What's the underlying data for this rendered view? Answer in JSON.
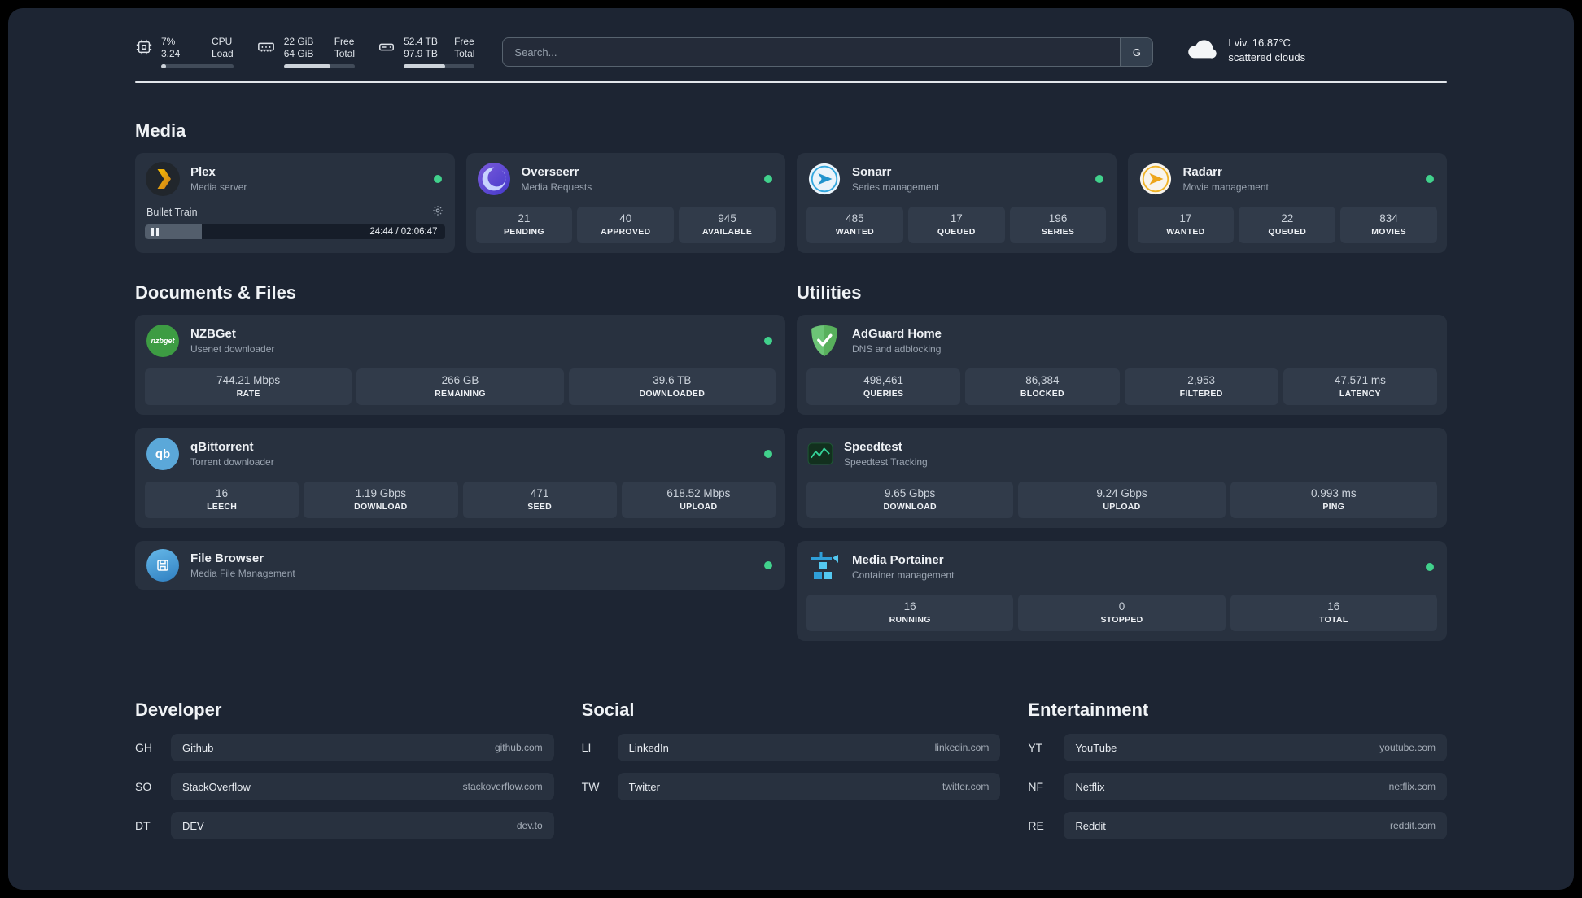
{
  "topbar": {
    "cpu": {
      "value": "7%",
      "total": "3.24",
      "label_top": "CPU",
      "label_bottom": "Load",
      "percent": 7
    },
    "ram": {
      "value": "22 GiB",
      "total": "64 GiB",
      "label_top": "Free",
      "label_bottom": "Total",
      "percent": 66
    },
    "disk": {
      "value": "52.4 TB",
      "total": "97.9 TB",
      "label_top": "Free",
      "label_bottom": "Total",
      "percent": 58
    },
    "search": {
      "placeholder": "Search...",
      "provider": "G"
    },
    "weather": {
      "location": "Lviv, 16.87°C",
      "condition": "scattered clouds"
    }
  },
  "sections": {
    "media": {
      "title": "Media",
      "plex": {
        "name": "Plex",
        "subtitle": "Media server",
        "player": {
          "track": "Bullet Train",
          "time": "24:44 / 02:06:47",
          "progress_percent": 19
        }
      },
      "overseerr": {
        "name": "Overseerr",
        "subtitle": "Media Requests",
        "stats": [
          {
            "value": "21",
            "label": "PENDING"
          },
          {
            "value": "40",
            "label": "APPROVED"
          },
          {
            "value": "945",
            "label": "AVAILABLE"
          }
        ]
      },
      "sonarr": {
        "name": "Sonarr",
        "subtitle": "Series management",
        "stats": [
          {
            "value": "485",
            "label": "WANTED"
          },
          {
            "value": "17",
            "label": "QUEUED"
          },
          {
            "value": "196",
            "label": "SERIES"
          }
        ]
      },
      "radarr": {
        "name": "Radarr",
        "subtitle": "Movie management",
        "stats": [
          {
            "value": "17",
            "label": "WANTED"
          },
          {
            "value": "22",
            "label": "QUEUED"
          },
          {
            "value": "834",
            "label": "MOVIES"
          }
        ]
      }
    },
    "documents": {
      "title": "Documents & Files",
      "nzbget": {
        "name": "NZBGet",
        "subtitle": "Usenet downloader",
        "icon_text": "nzbget",
        "stats": [
          {
            "value": "744.21 Mbps",
            "label": "RATE"
          },
          {
            "value": "266 GB",
            "label": "REMAINING"
          },
          {
            "value": "39.6 TB",
            "label": "DOWNLOADED"
          }
        ]
      },
      "qbittorrent": {
        "name": "qBittorrent",
        "subtitle": "Torrent downloader",
        "icon_text": "qb",
        "stats": [
          {
            "value": "16",
            "label": "LEECH"
          },
          {
            "value": "1.19 Gbps",
            "label": "DOWNLOAD"
          },
          {
            "value": "471",
            "label": "SEED"
          },
          {
            "value": "618.52 Mbps",
            "label": "UPLOAD"
          }
        ]
      },
      "filebrowser": {
        "name": "File Browser",
        "subtitle": "Media File Management"
      }
    },
    "utilities": {
      "title": "Utilities",
      "adguard": {
        "name": "AdGuard Home",
        "subtitle": "DNS and adblocking",
        "stats": [
          {
            "value": "498,461",
            "label": "QUERIES"
          },
          {
            "value": "86,384",
            "label": "BLOCKED"
          },
          {
            "value": "2,953",
            "label": "FILTERED"
          },
          {
            "value": "47.571 ms",
            "label": "LATENCY"
          }
        ]
      },
      "speedtest": {
        "name": "Speedtest",
        "subtitle": "Speedtest Tracking",
        "stats": [
          {
            "value": "9.65 Gbps",
            "label": "DOWNLOAD"
          },
          {
            "value": "9.24 Gbps",
            "label": "UPLOAD"
          },
          {
            "value": "0.993 ms",
            "label": "PING"
          }
        ]
      },
      "portainer": {
        "name": "Media Portainer",
        "subtitle": "Container management",
        "stats": [
          {
            "value": "16",
            "label": "RUNNING"
          },
          {
            "value": "0",
            "label": "STOPPED"
          },
          {
            "value": "16",
            "label": "TOTAL"
          }
        ]
      }
    },
    "bookmarks": {
      "developer": {
        "title": "Developer",
        "items": [
          {
            "abbr": "GH",
            "name": "Github",
            "domain": "github.com"
          },
          {
            "abbr": "SO",
            "name": "StackOverflow",
            "domain": "stackoverflow.com"
          },
          {
            "abbr": "DT",
            "name": "DEV",
            "domain": "dev.to"
          }
        ]
      },
      "social": {
        "title": "Social",
        "items": [
          {
            "abbr": "LI",
            "name": "LinkedIn",
            "domain": "linkedin.com"
          },
          {
            "abbr": "TW",
            "name": "Twitter",
            "domain": "twitter.com"
          }
        ]
      },
      "entertainment": {
        "title": "Entertainment",
        "items": [
          {
            "abbr": "YT",
            "name": "YouTube",
            "domain": "youtube.com"
          },
          {
            "abbr": "NF",
            "name": "Netflix",
            "domain": "netflix.com"
          },
          {
            "abbr": "RE",
            "name": "Reddit",
            "domain": "reddit.com"
          }
        ]
      }
    }
  },
  "colors": {
    "status_online": "#41d18c",
    "accent_green": "#34d399"
  }
}
